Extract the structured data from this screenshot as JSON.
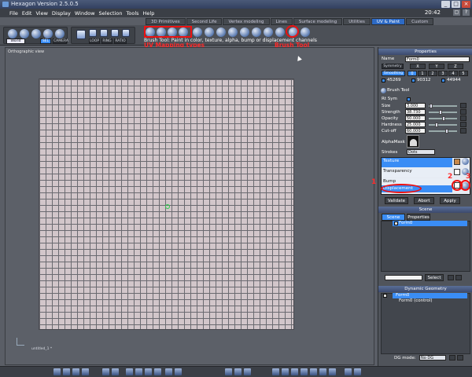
{
  "window": {
    "title": "Hexagon Version 2.5.0.5",
    "time": "20:42",
    "controls": [
      "_",
      "□",
      "×"
    ]
  },
  "menu": [
    "File",
    "Edit",
    "View",
    "Display",
    "Window",
    "Selection",
    "Tools",
    "Help"
  ],
  "tabs": [
    "3D Primitives",
    "Second Life",
    "Vertex modeling",
    "Lines",
    "Surface modeling",
    "Utilities",
    "UV & Paint",
    "Custom"
  ],
  "active_tab": "UV & Paint",
  "toolbar": {
    "coord_select": "World",
    "mode_labels": [
      "SEL",
      "CAMERA"
    ],
    "sel_labels": [
      "LOOP",
      "RING",
      "RATIO"
    ],
    "hint": "Brush Tool: Paint in color, texture, alpha, bump or displacement channels"
  },
  "annotations": {
    "uv_label": "UV Mapping types",
    "brush_label": "Brush Tool",
    "num1": "1",
    "num2": "2",
    "num3": "3",
    "color": "#ff2a2a"
  },
  "viewport": {
    "label": "Orthographic view",
    "doc_name": "untitled_1 *"
  },
  "properties": {
    "header": "Properties",
    "name_label": "Name",
    "name_value": "Form0",
    "symmetry_label": "Symmetry",
    "sym_buttons": [
      "X",
      "Y",
      "Z"
    ],
    "smoothing_label": "Smoothing",
    "smoothing_levels": [
      "0",
      "1",
      "2",
      "3",
      "4",
      "5"
    ],
    "stats": [
      "45269",
      "90312",
      "44944"
    ],
    "tool_title": "Brush Tool",
    "rt_sym_label": "Rt Sym",
    "params": [
      {
        "label": "Size",
        "value": "3.000"
      },
      {
        "label": "Strength",
        "value": "38.730"
      },
      {
        "label": "Opacity",
        "value": "50.000"
      },
      {
        "label": "Hardness",
        "value": "25.000"
      },
      {
        "label": "Cut-off",
        "value": "60.000"
      }
    ],
    "alphamask_label": "AlphaMask",
    "strokes_label": "Strokes",
    "strokes_value": "Dots",
    "channels": [
      "Texture",
      "Transparency",
      "Bump",
      "Displacement"
    ],
    "actions": [
      "Validate",
      "Abort",
      "Apply"
    ]
  },
  "scene": {
    "header": "Scene",
    "tabs": [
      "Scene tree",
      "Properties"
    ],
    "items": [
      "Form0"
    ],
    "select_label": "Select"
  },
  "dynamic_geometry": {
    "header": "Dynamic Geometry",
    "items": [
      "Form0",
      "Form0 (control)"
    ],
    "dg_mode_label": "DG mode:",
    "dg_mode_value": "No DG"
  }
}
